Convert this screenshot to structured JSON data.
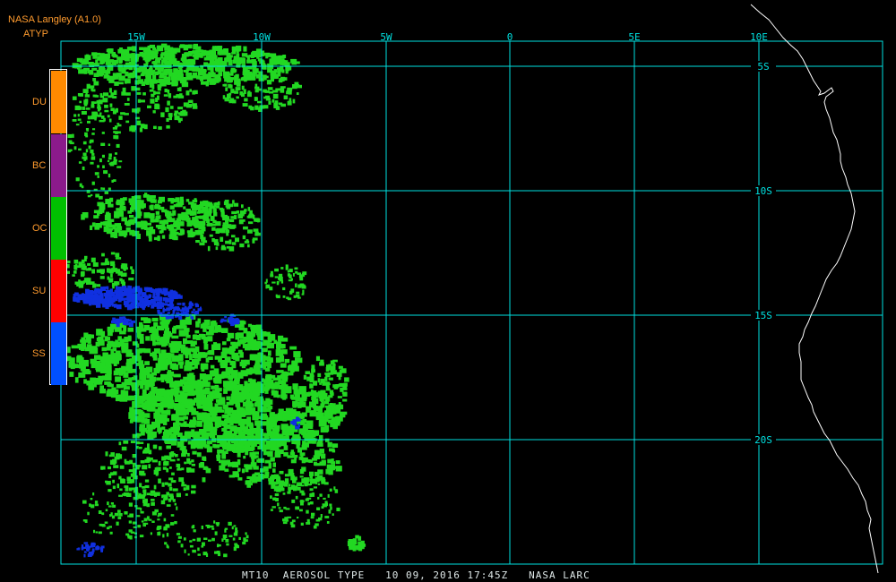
{
  "header": {
    "title": "NASA Langley (A1.0)",
    "parameter": "ATYP"
  },
  "legend": {
    "items": [
      {
        "label": "DU",
        "color": "#ff8a00"
      },
      {
        "label": "BC",
        "color": "#8b1a8b"
      },
      {
        "label": "OC",
        "color": "#00c000"
      },
      {
        "label": "SU",
        "color": "#ff0000"
      },
      {
        "label": "SS",
        "color": "#0050ff"
      }
    ]
  },
  "map": {
    "grid_color": "#00e0e0",
    "coast_color": "#ffffff",
    "aerosol_oc_color": "#22d822",
    "aerosol_ss_color": "#1030e0",
    "lon_labels": [
      "15W",
      "10W",
      "5W",
      "0",
      "5E",
      "10E"
    ],
    "lat_labels": [
      "5S",
      "10S",
      "15S",
      "20S"
    ]
  },
  "footer": {
    "text": "MT10  AEROSOL TYPE   10 09, 2016 17:45Z   NASA LARC"
  }
}
